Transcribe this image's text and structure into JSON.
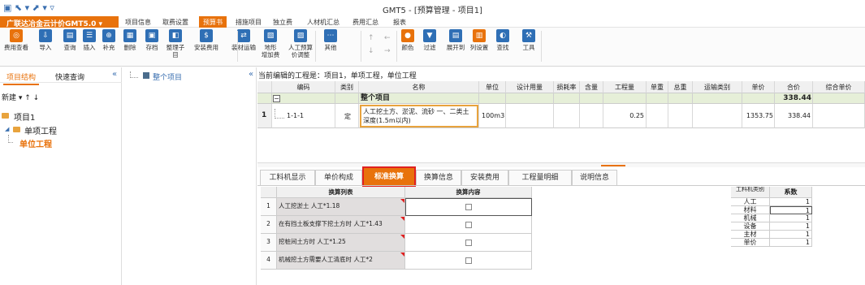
{
  "titlebar": {
    "title": "GMT5 - [预算管理 - 项目1]",
    "quick_access": "▣ ⬉ ▾ ⬈ ▾ ▿"
  },
  "app_menu": "广联达冶金云计价GMT5.0 ▾",
  "menubar": [
    "项目信息",
    "取费设置",
    "预算书",
    "措施项目",
    "独立费",
    "人材机汇总",
    "费用汇总",
    "报表"
  ],
  "ribbon": [
    {
      "label": "费用查看",
      "icon": "magnifier-icon",
      "color": "#e8720c"
    },
    {
      "label": "导入",
      "icon": "import-icon",
      "color": "#2f6fb5"
    },
    {
      "label": "查询",
      "icon": "query-icon",
      "color": "#2f6fb5"
    },
    {
      "label": "插入",
      "icon": "insert-icon",
      "color": "#2f6fb5"
    },
    {
      "label": "补充",
      "icon": "supplement-icon",
      "color": "#2f6fb5"
    },
    {
      "label": "删除",
      "icon": "delete-icon",
      "color": "#2f6fb5"
    },
    {
      "label": "存档",
      "icon": "archive-icon",
      "color": "#2f6fb5"
    },
    {
      "label": "整理子目",
      "icon": "organize-icon",
      "color": "#2f6fb5"
    },
    {
      "label": "安装费用",
      "icon": "install-fee-icon",
      "color": "#2f6fb5"
    },
    {
      "label": "装材运输",
      "icon": "transport-icon",
      "color": "#2f6fb5"
    },
    {
      "label": "地形\n增加费",
      "icon": "terrain-icon",
      "color": "#2f6fb5"
    },
    {
      "label": "人工预算\n价调整",
      "icon": "labor-adjust-icon",
      "color": "#2f6fb5"
    },
    {
      "label": "其他",
      "icon": "other-icon",
      "color": "#2f6fb5"
    },
    {
      "label": "颜色",
      "icon": "color-icon",
      "color": "#e8720c"
    },
    {
      "label": "过滤",
      "icon": "filter-icon",
      "color": "#2f6fb5"
    },
    {
      "label": "展开到",
      "icon": "expand-icon",
      "color": "#2f6fb5"
    },
    {
      "label": "列设置",
      "icon": "columns-icon",
      "color": "#e8720c"
    },
    {
      "label": "查找",
      "icon": "find-icon",
      "color": "#2f6fb5"
    },
    {
      "label": "工具",
      "icon": "tools-icon",
      "color": "#2f6fb5"
    }
  ],
  "left": {
    "tabs": [
      "项目结构",
      "快速查询"
    ],
    "new_label": "新建 ▾  ↑  ↓",
    "tree": [
      "项目1",
      "单项工程",
      "单位工程"
    ]
  },
  "mid": {
    "tree": "整个项目"
  },
  "current_label": "当前编辑的工程是：项目1，单项工程，单位工程",
  "grid": {
    "headers": [
      "编码",
      "类别",
      "名称",
      "单位",
      "设计用量",
      "损耗率",
      "含量",
      "工程量",
      "单重",
      "总重",
      "运输类别",
      "单价",
      "合价",
      "综合单价"
    ],
    "summary": {
      "name": "整个项目",
      "total": "338.44"
    },
    "row": {
      "num": "1",
      "code": "1-1-1",
      "type": "定",
      "name": "人工挖土方、淤泥、流砂 一、二类土 深度(1.5m以内)",
      "unit": "100m3",
      "qty": "0.25",
      "price": "1353.75",
      "total": "338.44"
    }
  },
  "bottom_tabs": [
    "工料机显示",
    "单价构成",
    "标准换算",
    "换算信息",
    "安装费用",
    "工程量明细",
    "说明信息"
  ],
  "conversion": {
    "headers": [
      "换算列表",
      "换算内容"
    ],
    "rows": [
      {
        "num": "1",
        "label": "人工挖淤土 人工*1.18"
      },
      {
        "num": "2",
        "label": "在有挡土板支撑下挖土方时 人工*1.43"
      },
      {
        "num": "3",
        "label": "挖桩间土方时 人工*1.25"
      },
      {
        "num": "4",
        "label": "机械挖土方需要人工清底时 人工*2"
      }
    ]
  },
  "factors": {
    "headers": [
      "工料机类别",
      "系数"
    ],
    "rows": [
      {
        "type": "人工",
        "value": "1"
      },
      {
        "type": "材料",
        "value": "1"
      },
      {
        "type": "机械",
        "value": "1"
      },
      {
        "type": "设备",
        "value": "1"
      },
      {
        "type": "主材",
        "value": "1"
      },
      {
        "type": "单价",
        "value": "1"
      }
    ]
  }
}
